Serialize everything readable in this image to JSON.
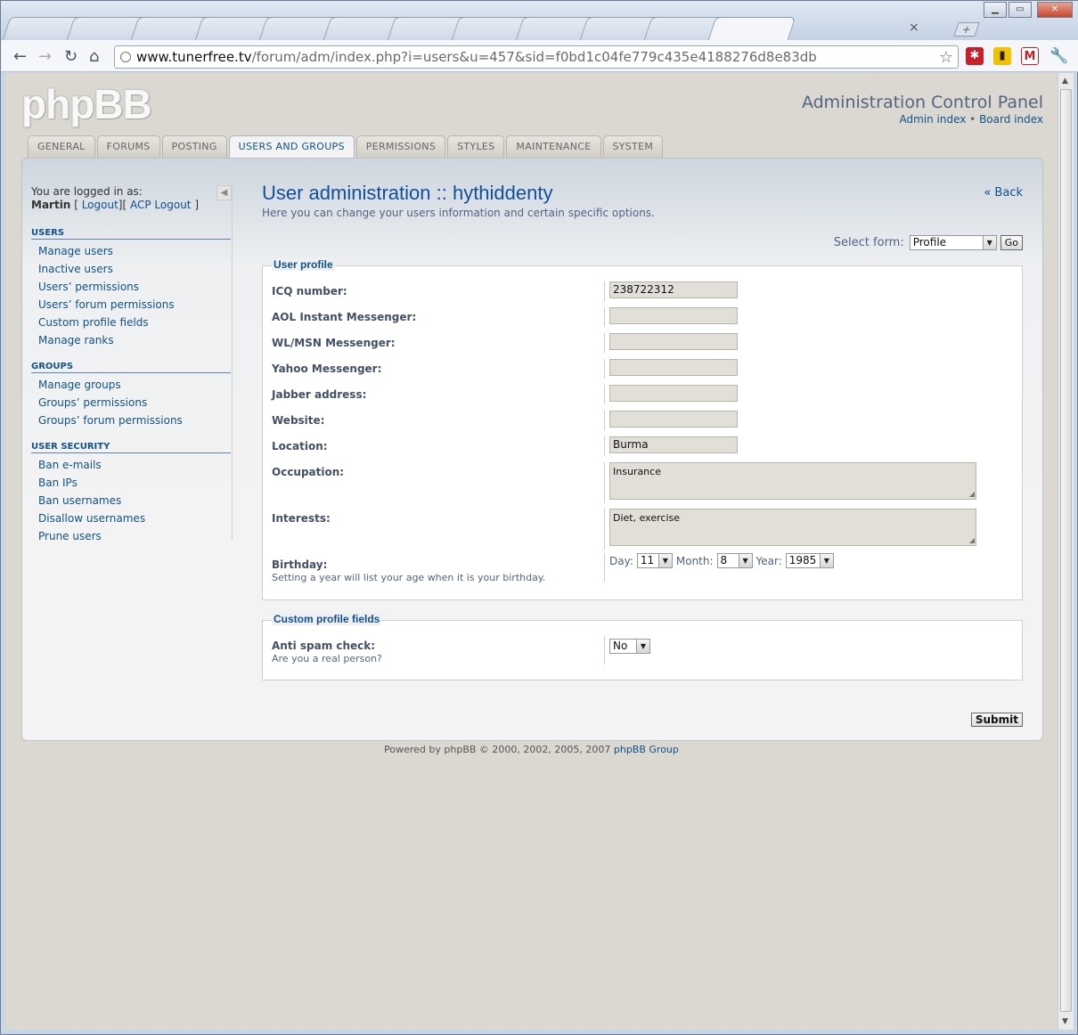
{
  "browser": {
    "url_host": "www.tunerfree.tv",
    "url_path": "/forum/adm/index.php?i=users&u=457&sid=f0bd1c04fe779c435e4188276d8e83db",
    "tab_close": "×",
    "new_tab": "+"
  },
  "header": {
    "logo": "phpBB",
    "title": "Administration Control Panel",
    "admin_index": "Admin index",
    "separator": "•",
    "board_index": "Board index"
  },
  "tabs": [
    "GENERAL",
    "FORUMS",
    "POSTING",
    "USERS AND GROUPS",
    "PERMISSIONS",
    "STYLES",
    "MAINTENANCE",
    "SYSTEM"
  ],
  "active_tab": "USERS AND GROUPS",
  "sidebar": {
    "logged_in_as": "You are logged in as:",
    "username": "Martin",
    "bracket_open": "[",
    "logout": "Logout",
    "bracket_mid": "][",
    "acp_logout": "ACP Logout",
    "bracket_close": "]",
    "sections": [
      {
        "title": "USERS",
        "items": [
          "Manage users",
          "Inactive users",
          "Users’ permissions",
          "Users’ forum permissions",
          "Custom profile fields",
          "Manage ranks"
        ]
      },
      {
        "title": "GROUPS",
        "items": [
          "Manage groups",
          "Groups’ permissions",
          "Groups’ forum permissions"
        ]
      },
      {
        "title": "USER SECURITY",
        "items": [
          "Ban e-mails",
          "Ban IPs",
          "Ban usernames",
          "Disallow usernames",
          "Prune users"
        ]
      }
    ]
  },
  "main": {
    "title": "User administration :: hythiddenty",
    "description": "Here you can change your users information and certain specific options.",
    "back": "« Back",
    "select_form_label": "Select form:",
    "select_form_value": "Profile",
    "go_button": "Go",
    "profile_legend": "User profile",
    "profile_fields": {
      "icq_label": "ICQ number:",
      "icq_value": "238722312",
      "aim_label": "AOL Instant Messenger:",
      "aim_value": "",
      "msn_label": "WL/MSN Messenger:",
      "msn_value": "",
      "yahoo_label": "Yahoo Messenger:",
      "yahoo_value": "",
      "jabber_label": "Jabber address:",
      "jabber_value": "",
      "website_label": "Website:",
      "website_value": "",
      "location_label": "Location:",
      "location_value": "Burma",
      "occupation_label": "Occupation:",
      "occupation_value": "Insurance",
      "interests_label": "Interests:",
      "interests_value": "Diet, exercise",
      "birthday_label": "Birthday:",
      "birthday_hint": "Setting a year will list your age when it is your birthday.",
      "day_label": "Day:",
      "day_value": "11",
      "month_label": "Month:",
      "month_value": "8",
      "year_label": "Year:",
      "year_value": "1985"
    },
    "custom_legend": "Custom profile fields",
    "antispam_label": "Anti spam check:",
    "antispam_hint": "Are you a real person?",
    "antispam_value": "No",
    "submit": "Submit"
  },
  "footer": {
    "text": "Powered by phpBB © 2000, 2002, 2005, 2007",
    "group_link": "phpBB Group"
  }
}
